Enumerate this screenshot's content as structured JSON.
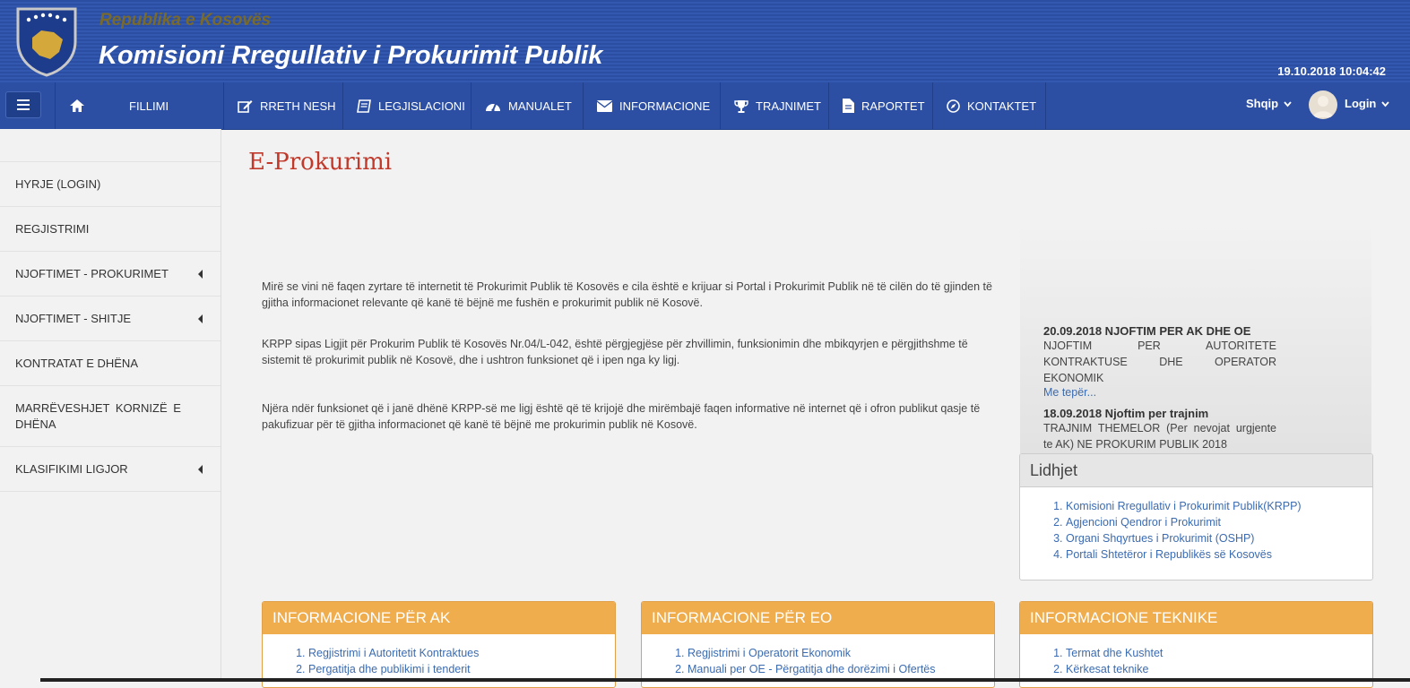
{
  "header": {
    "republic": "Republika e Kosovës",
    "agency": "Komisioni Rregullativ i Prokurimit Publik",
    "datetime": "19.10.2018 10:04:42"
  },
  "nav": {
    "items": [
      {
        "label": "FILLIMI",
        "icon": "home-icon"
      },
      {
        "label": "RRETH NESH",
        "icon": "edit-icon"
      },
      {
        "label": "LEGJISLACIONI",
        "icon": "book-icon"
      },
      {
        "label": "MANUALET",
        "icon": "dashboard-icon"
      },
      {
        "label": "INFORMACIONE",
        "icon": "envelope-icon"
      },
      {
        "label": "TRAJNIMET",
        "icon": "trophy-icon"
      },
      {
        "label": "RAPORTET",
        "icon": "document-icon"
      },
      {
        "label": "KONTAKTET",
        "icon": "compass-icon"
      }
    ],
    "language": "Shqip",
    "login": "Login"
  },
  "sidebar": {
    "items": [
      {
        "label": "HYRJE (LOGIN)"
      },
      {
        "label": "REGJISTRIMI"
      },
      {
        "label": "NJOFTIMET - PROKURIMET"
      },
      {
        "label": "NJOFTIMET - SHITJE"
      },
      {
        "label": "KONTRATAT E DHËNA"
      },
      {
        "label": "MARRËVESHJET KORNIZË E DHËNA"
      },
      {
        "label": "KLASIFIKIMI LIGJOR"
      }
    ]
  },
  "main": {
    "title": "E-Prokurimi",
    "paragraphs": [
      "Mirë se vini në faqen zyrtare të internetit të Prokurimit Publik të Kosovës e cila është e krijuar si Portal i Prokurimit Publik në të cilën do të gjinden të gjitha informacionet relevante që kanë të bëjnë me fushën e prokurimit publik në Kosovë.",
      "KRPP sipas Ligjit për Prokurim Publik të Kosovës Nr.04/L-042, është përgjegjëse për zhvillimin, funksionimin dhe mbikqyrjen e përgjithshme të sistemit të prokurimit publik në Kosovë, dhe i ushtron funksionet që i ipen nga ky ligj.",
      "Njëra ndër funksionet që i janë dhënë KRPP-së me ligj është që të krijojë dhe mirëmbajë faqen informative në internet që i ofron publikut qasje të pakufizuar për të gjitha informacionet që kanë të bëjnë me prokurimin publik në Kosovë."
    ]
  },
  "news": [
    {
      "title": "20.09.2018 NJOFTIM PER AK DHE OE",
      "body": "NJOFTIM PER AUTORITETE KONTRAKTUSE DHE OPERATOR EKONOMIK",
      "more": "Me tepër..."
    },
    {
      "title": "18.09.2018 Njoftim per trajnim",
      "body": "TRAJNIM THEMELOR (Per nevojat urgjente te AK) NE PROKURIM PUBLIK 2018",
      "more": ""
    }
  ],
  "links": {
    "title": "Lidhjet",
    "items": [
      "Komisioni Rregullativ i Prokurimit Publik(KRPP)",
      "Agjencioni Qendror i Prokurimit",
      "Organi Shqyrtues i Prokurimit (OSHP)",
      "Portali Shtetëror i Republikës së Kosovës"
    ]
  },
  "info_panels": [
    {
      "title": "INFORMACIONE PËR AK",
      "items": [
        "Regjistrimi i Autoritetit Kontraktues",
        "Pergatitja dhe publikimi i tenderit"
      ]
    },
    {
      "title": "INFORMACIONE PËR EO",
      "items": [
        "Regjistrimi i Operatorit Ekonomik",
        "Manuali per OE - Përgatitja dhe dorëzimi i Ofertës"
      ]
    },
    {
      "title": "INFORMACIONE TEKNIKE",
      "items": [
        "Termat dhe Kushtet",
        "Kërkesat teknike"
      ]
    }
  ],
  "colors": {
    "header_blue": "#2b4ea3",
    "title_red": "#c0392b",
    "panel_orange": "#f0ad4e",
    "link_blue": "#3b6bb0"
  }
}
